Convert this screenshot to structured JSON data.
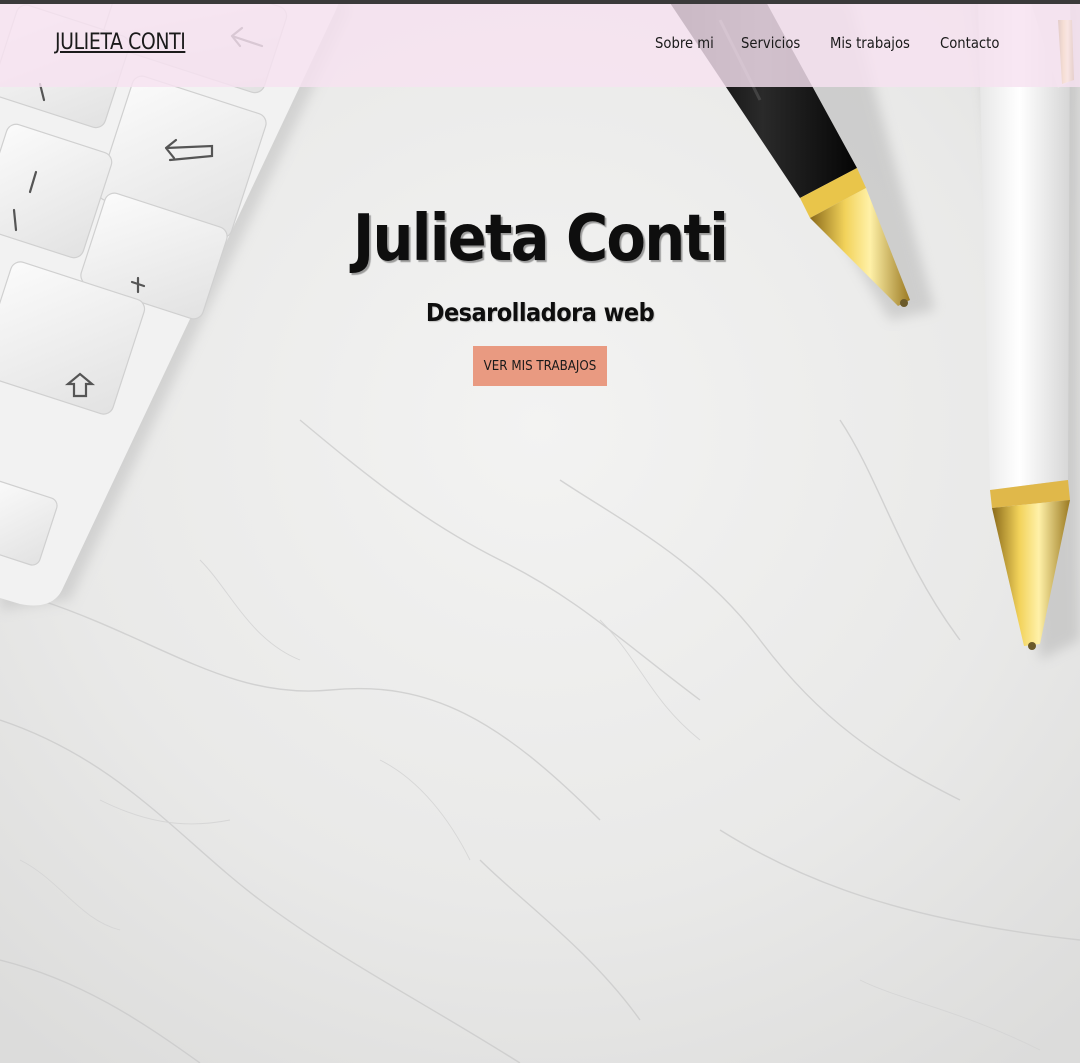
{
  "navbar": {
    "brand": "JULIETA CONTI",
    "links": [
      "Sobre mi",
      "Servicios",
      "Mis trabajos",
      "Contacto"
    ]
  },
  "hero": {
    "title": "Julieta Conti",
    "subtitle": "Desarolladora web",
    "cta_label": "VER MIS TRABAJOS"
  },
  "colors": {
    "navbar_bg": "#f6e2f0",
    "cta_bg": "#e99a81",
    "text": "#0e0e0e"
  }
}
